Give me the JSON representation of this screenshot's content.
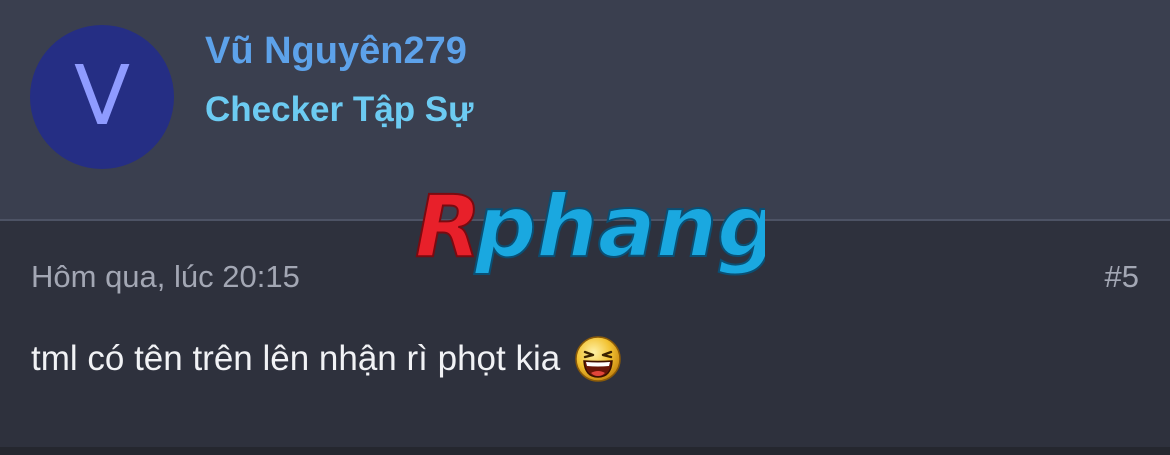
{
  "author": {
    "avatar_letter": "V",
    "name": "Vũ Nguyên279",
    "title": "Checker Tập Sự"
  },
  "post": {
    "timestamp": "Hôm qua, lúc 20:15",
    "number": "#5",
    "message": "tml có tên trên lên nhận rì phọt kia",
    "emoji": "laughing-smiley-icon"
  },
  "watermark": {
    "text": "Rphang"
  },
  "colors": {
    "header_bg": "#3a3f4f",
    "body_bg": "#2e313d",
    "avatar_bg": "#252e84",
    "avatar_letter": "#8f9bff",
    "username": "#5da2ea",
    "user_title": "#6ccbf2",
    "meta_text": "#a3a7b4",
    "message_text": "#f1f2f5",
    "watermark_red": "#e8202a",
    "watermark_blue": "#1aa8e0"
  }
}
